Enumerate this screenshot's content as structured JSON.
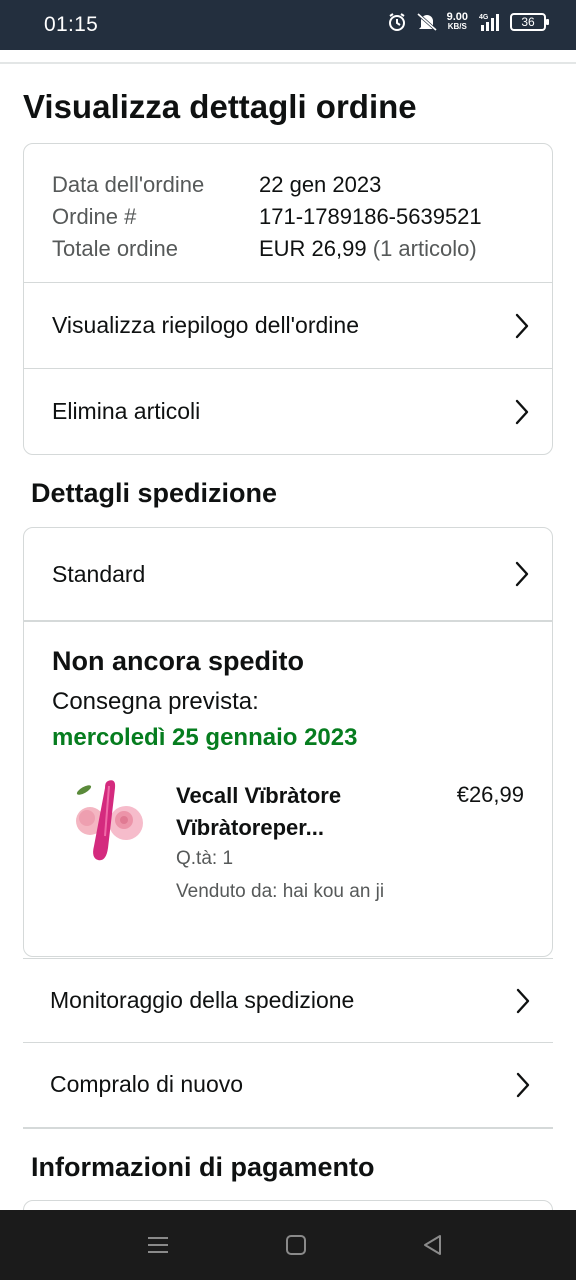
{
  "status_bar": {
    "time": "01:15",
    "net_speed": "9.00",
    "net_unit": "KB/S",
    "network": "4G",
    "battery": "36",
    "icons": [
      "alarm-icon",
      "mute-icon",
      "signal-icon",
      "battery-icon"
    ]
  },
  "page": {
    "title": "Visualizza dettagli ordine"
  },
  "order_summary": {
    "date_label": "Data dell'ordine",
    "date_value": "22 gen 2023",
    "order_label": "Ordine #",
    "order_value": "171-1789186-5639521",
    "total_label": "Totale ordine",
    "total_value": "EUR 26,99",
    "total_items": "(1 articolo)",
    "view_summary_label": "Visualizza riepilogo dell'ordine",
    "delete_items_label": "Elimina articoli"
  },
  "shipping": {
    "section_title": "Dettagli spedizione",
    "method": "Standard",
    "status": "Non ancora spedito",
    "delivery_label": "Consegna prevista:",
    "delivery_date": "mercoledì 25 gennaio 2023",
    "item": {
      "name": "Vecall Vïbràtore Vïbràtoreper...",
      "price": "€26,99",
      "qty": "Q.tà: 1",
      "seller": "Venduto da: hai kou an ji"
    },
    "track_label": "Monitoraggio della spedizione",
    "buy_again_label": "Compralo di nuovo"
  },
  "payment": {
    "section_title": "Informazioni di pagamento"
  },
  "colors": {
    "header_bg": "#232f3e",
    "delivery_green": "#067d1f",
    "border": "#d5d9d9",
    "muted_text": "#565959"
  }
}
